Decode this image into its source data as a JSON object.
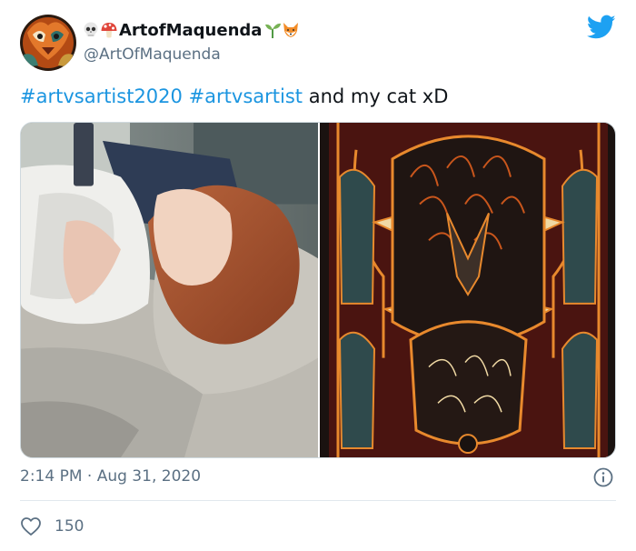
{
  "author": {
    "emoji_before": [
      "skull",
      "mushroom"
    ],
    "display_name": "ArtofMaquenda",
    "emoji_after": [
      "seedling",
      "fox-face"
    ],
    "handle": "@ArtOfMaquenda"
  },
  "tweet": {
    "hashtags": [
      "#artvsartist2020",
      "#artvsartist"
    ],
    "text_tail": "and my cat xD",
    "timestamp": "2:14 PM · Aug 31, 2020"
  },
  "media": {
    "left_photo": "photo of girl with red hair lying in bed holding phone",
    "right_artwork": "ornate orange and teal cat artwork"
  },
  "engagement": {
    "like_count": "150"
  },
  "icons": {
    "platform": "twitter-bird-icon",
    "info": "info-icon",
    "like": "heart-icon"
  },
  "colors": {
    "hashtag": "#1b95e0",
    "secondary_text": "#5b7083",
    "twitter_blue": "#1da1f2"
  }
}
